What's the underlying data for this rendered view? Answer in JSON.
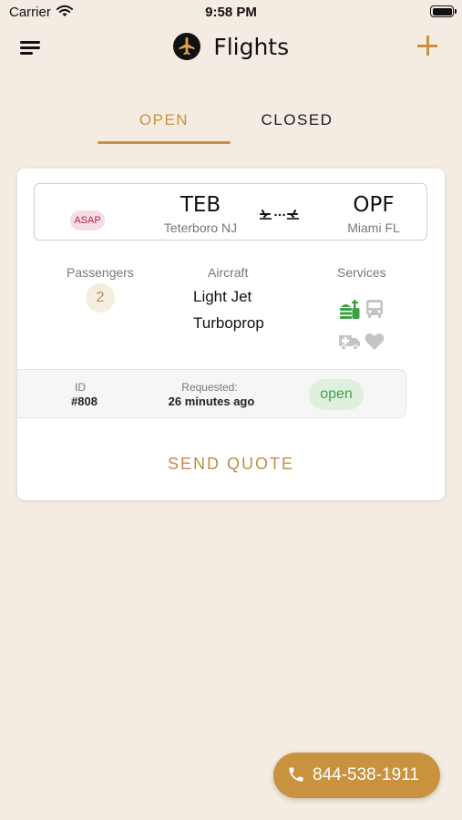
{
  "status_bar": {
    "carrier": "Carrier",
    "time": "9:58 PM"
  },
  "nav": {
    "title": "Flights",
    "icons": [
      "menu-icon",
      "plane-logo-icon",
      "plus-icon"
    ]
  },
  "tabs": [
    {
      "label": "OPEN",
      "active": true
    },
    {
      "label": "CLOSED",
      "active": false
    }
  ],
  "flight": {
    "priority": "ASAP",
    "from": {
      "code": "TEB",
      "city": "Teterboro NJ"
    },
    "to": {
      "code": "OPF",
      "city": "Miami FL"
    },
    "passengers_label": "Passengers",
    "passengers": "2",
    "aircraft_label": "Aircraft",
    "aircraft": [
      "Light Jet",
      "Turboprop"
    ],
    "services_label": "Services",
    "services": [
      {
        "icon": "catering-icon",
        "active": true
      },
      {
        "icon": "bus-icon",
        "active": false
      },
      {
        "icon": "ambulance-icon",
        "active": false
      },
      {
        "icon": "heart-icon",
        "active": false
      }
    ],
    "id_label": "ID",
    "id": "#808",
    "requested_label": "Requested:",
    "requested": "26 minutes ago",
    "status": "open",
    "send_quote": "SEND QUOTE"
  },
  "call_button": {
    "phone": "844-538-1911"
  },
  "colors": {
    "accent": "#c9923f",
    "background": "#f4ece2",
    "asap": "#b32449",
    "open_status": "#3f9f46"
  }
}
